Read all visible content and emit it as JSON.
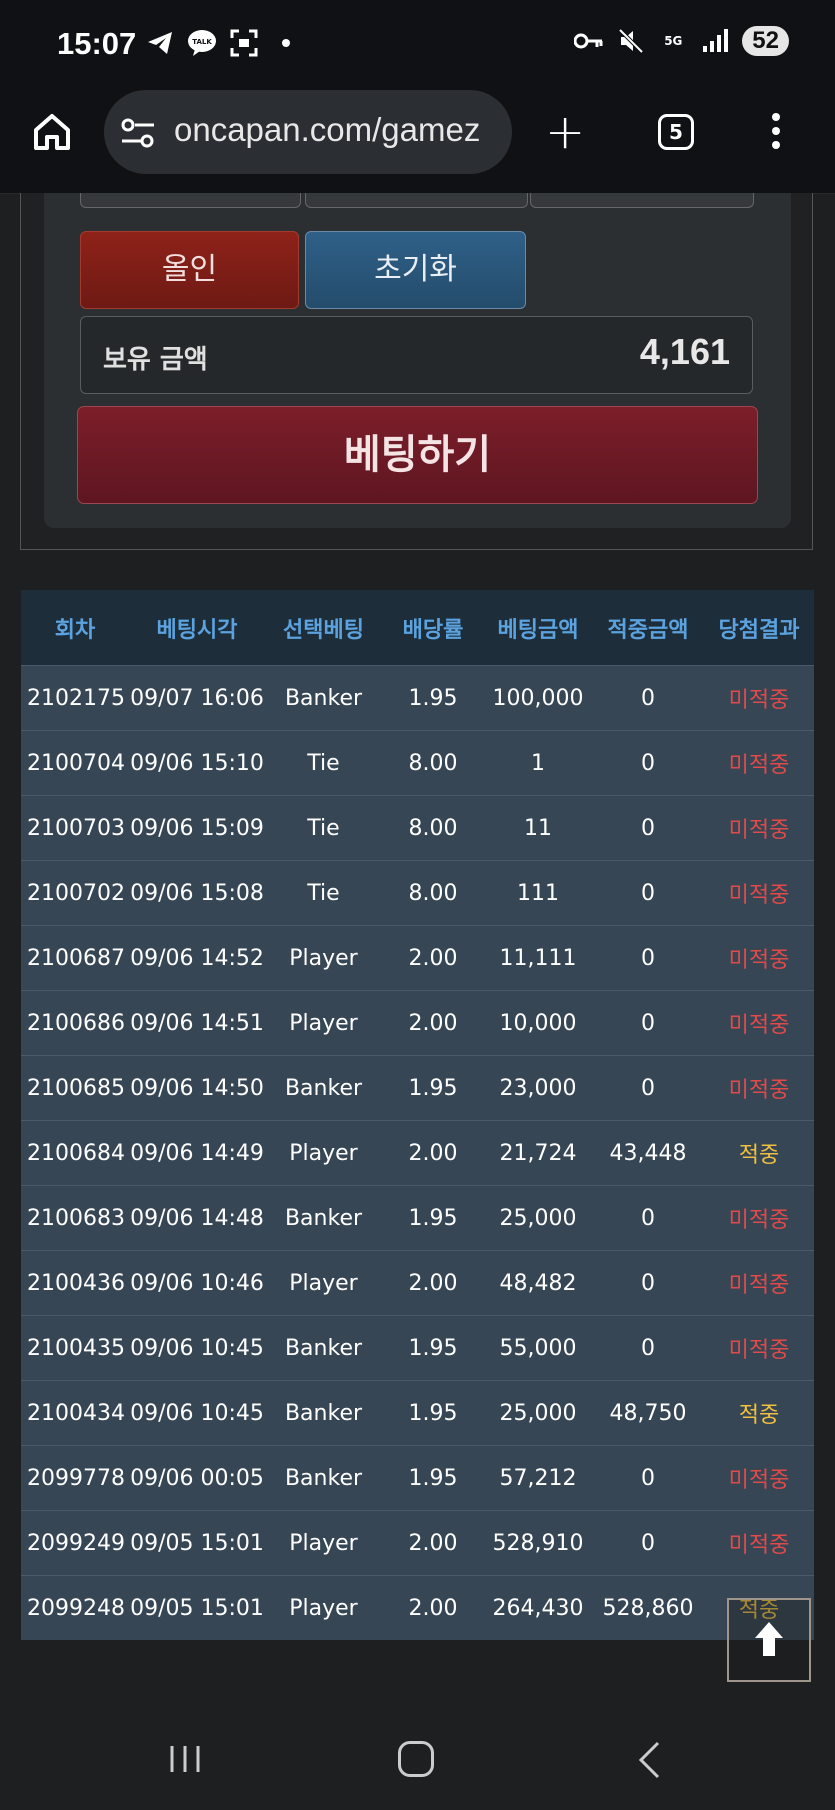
{
  "status_bar": {
    "time": "15:07",
    "talk_label": "TALK",
    "network_label": "5G",
    "battery": "52",
    "icons": [
      "telegram-icon",
      "kakaotalk-icon",
      "screenshot-icon",
      "dot-icon",
      "key-icon",
      "mute-icon",
      "signal-icon"
    ]
  },
  "browser": {
    "url": "oncapan.com/gamez",
    "tab_count": "5"
  },
  "bet_panel": {
    "allin_label": "올인",
    "reset_label": "초기화",
    "balance_label": "보유 금액",
    "balance_value": "4,161",
    "bet_label": "베팅하기"
  },
  "history": {
    "headers": [
      "회차",
      "베팅시각",
      "선택베팅",
      "배당률",
      "베팅금액",
      "적중금액",
      "당첨결과"
    ],
    "rows": [
      [
        "2102175",
        "09/07 16:06",
        "Banker",
        "1.95",
        "100,000",
        "0",
        "미적중"
      ],
      [
        "2100704",
        "09/06 15:10",
        "Tie",
        "8.00",
        "1",
        "0",
        "미적중"
      ],
      [
        "2100703",
        "09/06 15:09",
        "Tie",
        "8.00",
        "11",
        "0",
        "미적중"
      ],
      [
        "2100702",
        "09/06 15:08",
        "Tie",
        "8.00",
        "111",
        "0",
        "미적중"
      ],
      [
        "2100687",
        "09/06 14:52",
        "Player",
        "2.00",
        "11,111",
        "0",
        "미적중"
      ],
      [
        "2100686",
        "09/06 14:51",
        "Player",
        "2.00",
        "10,000",
        "0",
        "미적중"
      ],
      [
        "2100685",
        "09/06 14:50",
        "Banker",
        "1.95",
        "23,000",
        "0",
        "미적중"
      ],
      [
        "2100684",
        "09/06 14:49",
        "Player",
        "2.00",
        "21,724",
        "43,448",
        "적중"
      ],
      [
        "2100683",
        "09/06 14:48",
        "Banker",
        "1.95",
        "25,000",
        "0",
        "미적중"
      ],
      [
        "2100436",
        "09/06 10:46",
        "Player",
        "2.00",
        "48,482",
        "0",
        "미적중"
      ],
      [
        "2100435",
        "09/06 10:45",
        "Banker",
        "1.95",
        "55,000",
        "0",
        "미적중"
      ],
      [
        "2100434",
        "09/06 10:45",
        "Banker",
        "1.95",
        "25,000",
        "48,750",
        "적중"
      ],
      [
        "2099778",
        "09/06 00:05",
        "Banker",
        "1.95",
        "57,212",
        "0",
        "미적중"
      ],
      [
        "2099249",
        "09/05 15:01",
        "Player",
        "2.00",
        "528,910",
        "0",
        "미적중"
      ],
      [
        "2099248",
        "09/05 15:01",
        "Player",
        "2.00",
        "264,430",
        "528,860",
        "적중"
      ]
    ]
  },
  "colors": {
    "header_text": "#5ba2df",
    "row_bg": "#364654",
    "lose": "#e24a4a",
    "win": "#f0c040"
  }
}
